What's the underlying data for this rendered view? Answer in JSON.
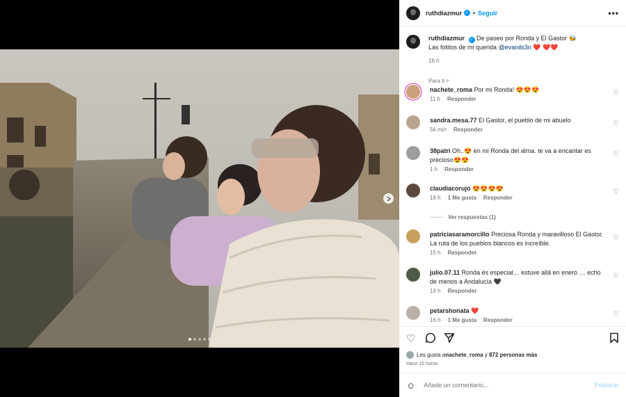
{
  "post": {
    "username": "ruthdiazmur",
    "follow_label": "Seguir",
    "more_label": "•••",
    "caption_line1": "De paseo por Ronda y El Gastor 🐝",
    "caption_line2_prefix": "Las fotitos de mi querida ",
    "caption_mention": "@evanils3n",
    "caption_hearts": "❤️ ❤️❤️",
    "caption_time": "16 h",
    "for_you_label": "Para ti ▿"
  },
  "comments": [
    {
      "user": "nachete_roma",
      "text": "Por mi Ronda! 😍😍😍",
      "time": "11 h",
      "likes": "",
      "reply": "Responder"
    },
    {
      "user": "sandra.mesa.77",
      "text": "El Gastor, el pueblo de mi abuelo",
      "time": "56 min",
      "likes": "",
      "reply": "Responder"
    },
    {
      "user": "38patri",
      "text": "Oh..😍 en mi Ronda del alma. te va a encantar es precioso😍😍",
      "time": "1 h",
      "likes": "",
      "reply": "Responder"
    },
    {
      "user": "claudiacorujo",
      "text": "😍😍😍😍",
      "time": "16 h",
      "likes": "1 Me gusta",
      "reply": "Responder",
      "view_replies": "Ver respuestas (1)"
    },
    {
      "user": "patriciasaramorcillo",
      "text": "Preciosa Ronda y maravilloso El Gastor. La ruta de los pueblos blancos es increíble.",
      "time": "15 h",
      "likes": "",
      "reply": "Responder"
    },
    {
      "user": "julio.07.11",
      "text": "Ronda és especial… estuve allá en enero … echo de menos a Andalucía 🖤",
      "time": "16 h",
      "likes": "",
      "reply": "Responder"
    },
    {
      "user": "petarshonata",
      "text": "❤️",
      "time": "16 h",
      "likes": "1 Me gusta",
      "reply": "Responder"
    }
  ],
  "like_icon": "♡",
  "actions": {
    "like_icon": "heart-outline-icon",
    "comment_icon": "comment-bubble-icon",
    "share_icon": "paper-plane-icon",
    "save_icon": "bookmark-icon",
    "likes_prefix": "Les gusta a ",
    "likes_user": "nachete_roma",
    "likes_mid": " y ",
    "likes_count": "872 personas más",
    "time_ago": "Hace 16 horas"
  },
  "composer": {
    "placeholder": "Añade un comentario...",
    "publish_label": "Publicar"
  },
  "carousel": {
    "total": 5,
    "active": 1
  }
}
